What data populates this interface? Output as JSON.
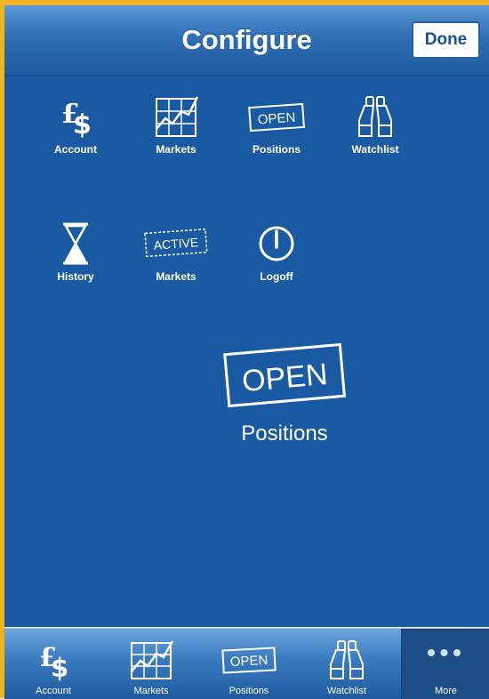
{
  "nav": {
    "title": "Configure",
    "done_label": "Done"
  },
  "grid": [
    {
      "label": "Account",
      "icon": "account-currency-icon"
    },
    {
      "label": "Markets",
      "icon": "markets-chart-icon"
    },
    {
      "label": "Positions",
      "icon": "open-positions-icon",
      "icon_text": "OPEN"
    },
    {
      "label": "Watchlist",
      "icon": "binoculars-icon"
    },
    {
      "label": "History",
      "icon": "hourglass-icon"
    },
    {
      "label": "Markets",
      "icon": "active-markets-icon",
      "icon_text": "ACTIVE"
    },
    {
      "label": "Logoff",
      "icon": "power-icon"
    }
  ],
  "dragging": {
    "label": "Positions",
    "icon": "open-positions-icon",
    "icon_text": "OPEN"
  },
  "tabbar": [
    {
      "label": "Account",
      "icon": "account-currency-icon"
    },
    {
      "label": "Markets",
      "icon": "markets-chart-icon"
    },
    {
      "label": "Positions",
      "icon": "open-positions-icon",
      "icon_text": "OPEN"
    },
    {
      "label": "Watchlist",
      "icon": "binoculars-icon"
    },
    {
      "label": "More",
      "icon": "more-dots-icon"
    }
  ],
  "colors": {
    "background": "#1a5aa2",
    "accent_border": "#f0b323",
    "nav": "#2f6fb5"
  }
}
